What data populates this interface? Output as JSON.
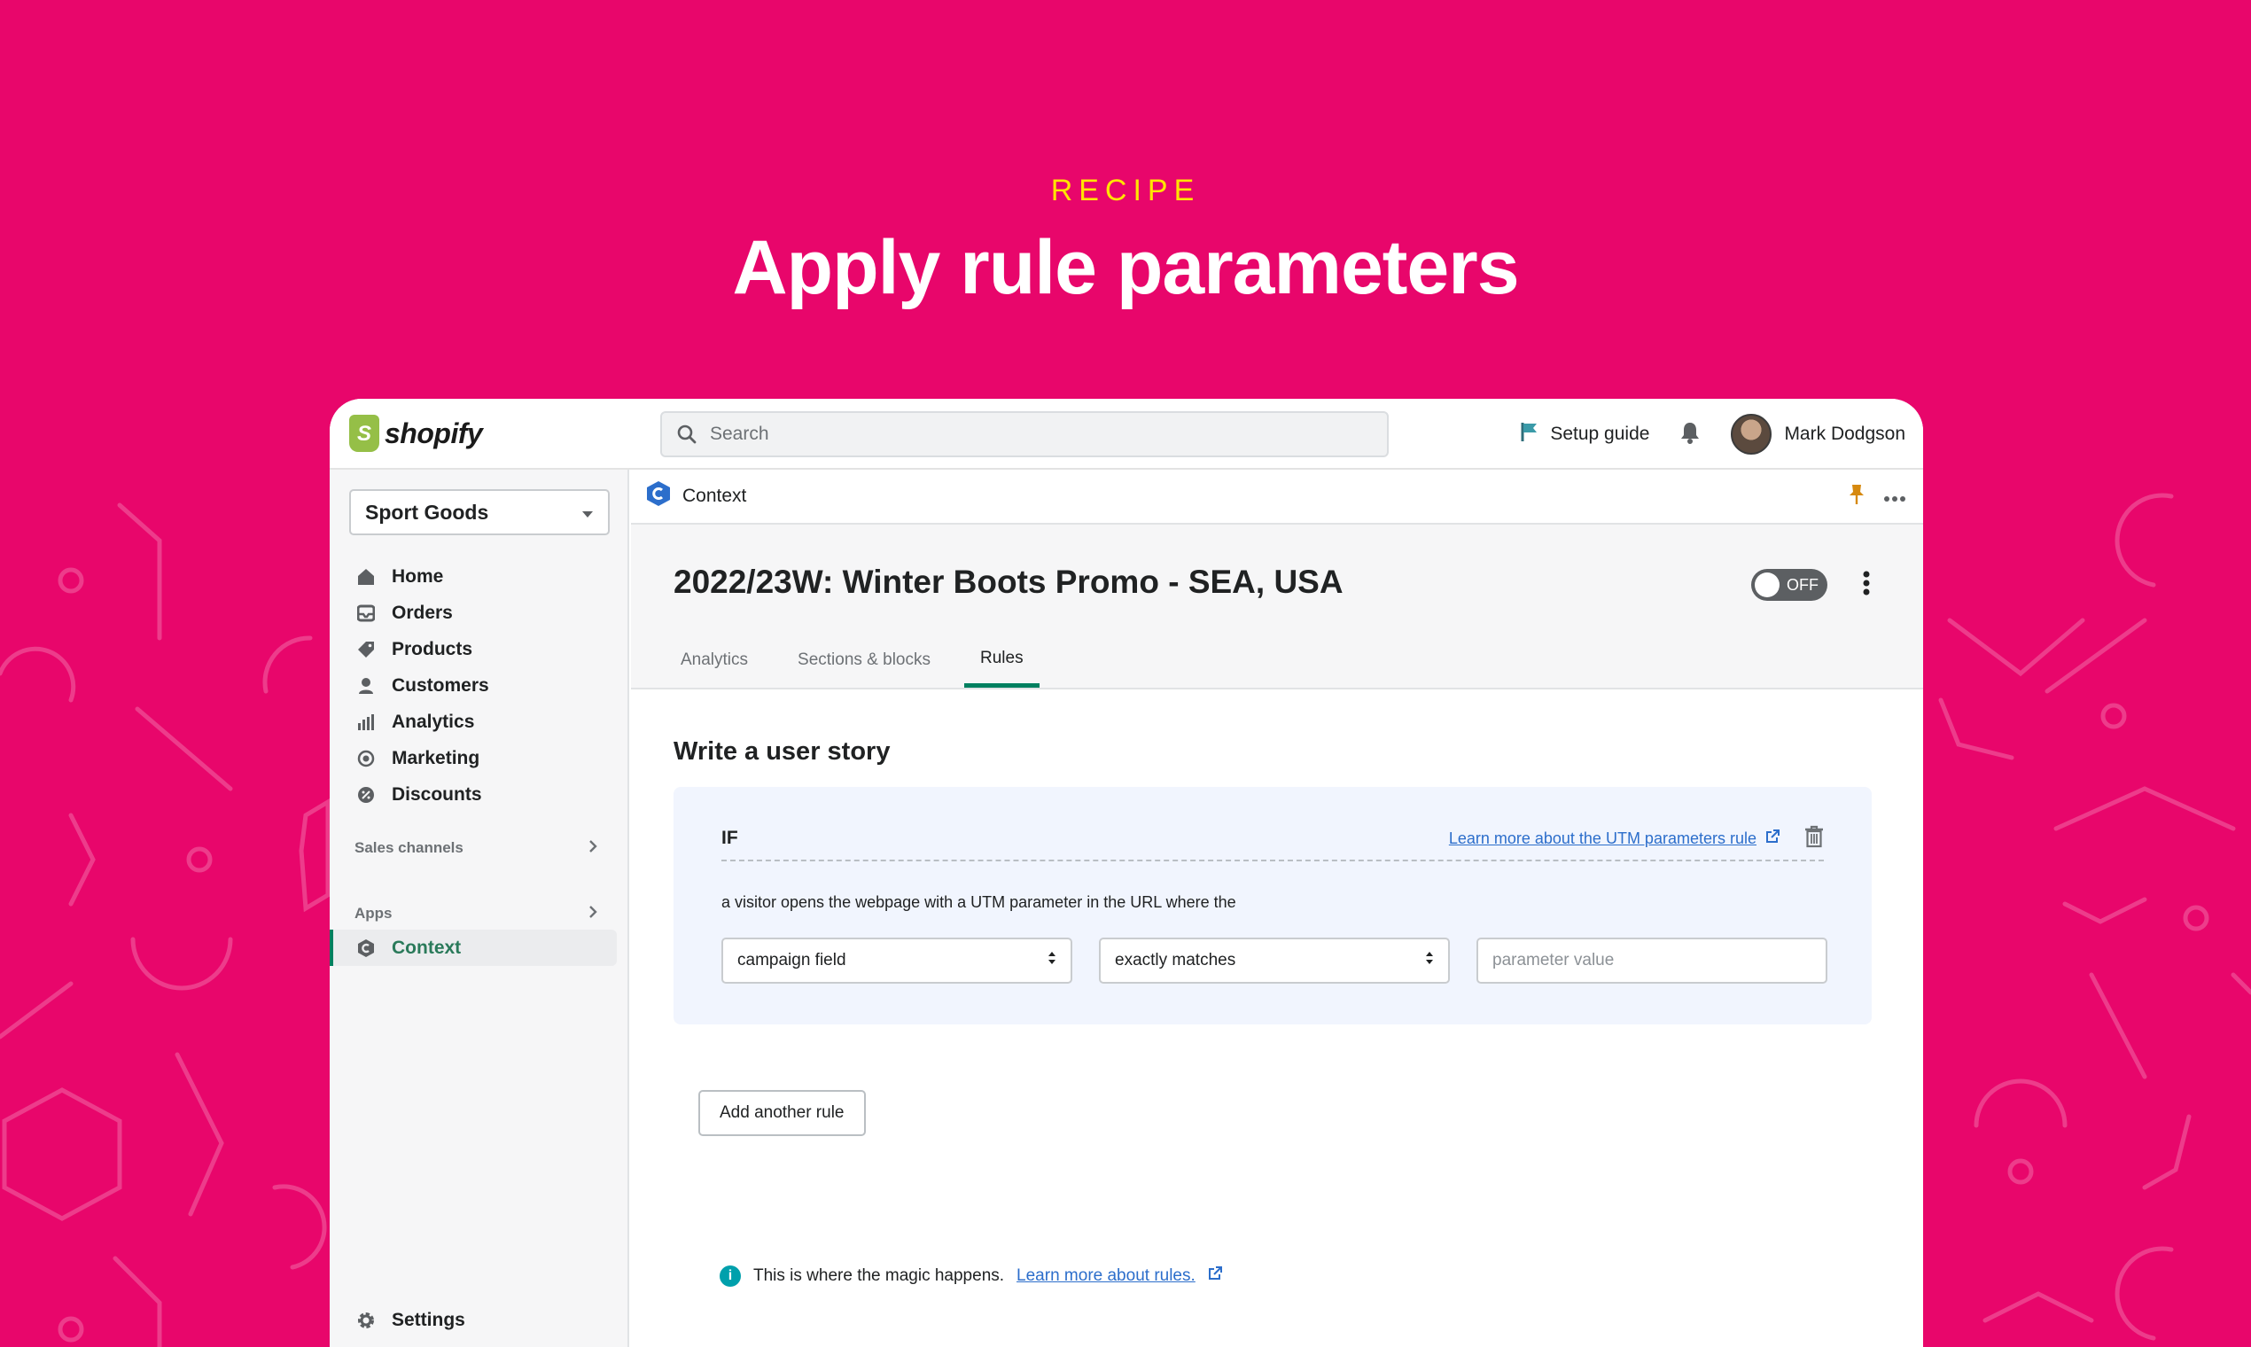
{
  "hero": {
    "eyebrow": "RECIPE",
    "title": "Apply rule parameters"
  },
  "colors": {
    "background": "#e8066b",
    "eyebrow": "#ffe500",
    "accent": "#008060",
    "link": "#2c6ecb"
  },
  "topbar": {
    "logo_text": "shopify",
    "search_placeholder": "Search",
    "setup_guide_label": "Setup guide",
    "user_name": "Mark Dodgson"
  },
  "sidebar": {
    "store_name": "Sport Goods",
    "items": [
      {
        "label": "Home",
        "icon": "home-icon"
      },
      {
        "label": "Orders",
        "icon": "orders-icon"
      },
      {
        "label": "Products",
        "icon": "tag-icon"
      },
      {
        "label": "Customers",
        "icon": "person-icon"
      },
      {
        "label": "Analytics",
        "icon": "bar-chart-icon"
      },
      {
        "label": "Marketing",
        "icon": "target-icon"
      },
      {
        "label": "Discounts",
        "icon": "discount-icon"
      }
    ],
    "sales_channels_label": "Sales channels",
    "apps_label": "Apps",
    "active_app": "Context",
    "settings_label": "Settings"
  },
  "appbar": {
    "app_name": "Context"
  },
  "page": {
    "title": "2022/23W: Winter Boots Promo - SEA, USA",
    "toggle_label": "OFF",
    "tabs": [
      {
        "label": "Analytics",
        "active": false
      },
      {
        "label": "Sections & blocks",
        "active": false
      },
      {
        "label": "Rules",
        "active": true
      }
    ]
  },
  "rules": {
    "section_title": "Write a user story",
    "if_label": "IF",
    "learn_more_label": "Learn more about the UTM parameters rule",
    "description": "a visitor opens the webpage with a UTM parameter in the URL where the",
    "field_select": "campaign field",
    "operator_select": "exactly matches",
    "value_placeholder": "parameter value",
    "add_rule_label": "Add another rule"
  },
  "footer": {
    "note": "This is where the magic happens.",
    "link_label": "Learn more about rules."
  }
}
